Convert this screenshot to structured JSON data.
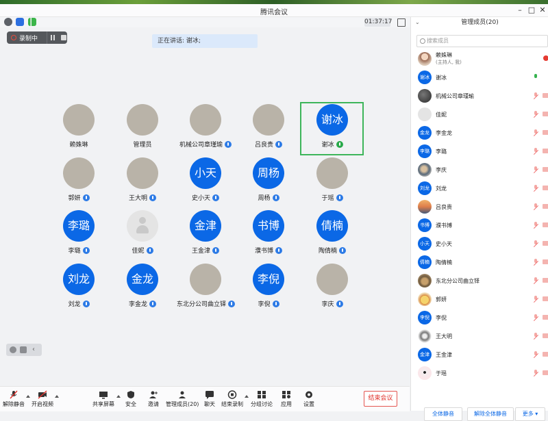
{
  "window": {
    "title": "腾讯会议",
    "minimize_icon": "minimize-icon",
    "maximize_icon": "maximize-icon",
    "close_icon": "close-icon"
  },
  "statusbar": {
    "timer": "01:37:17"
  },
  "recording": {
    "label": "录制中"
  },
  "speaking": {
    "text": "正在讲话: 谢冰;"
  },
  "grid": [
    {
      "name": "赖姝琳",
      "initials": "",
      "style": "photo-kid",
      "mic": "none"
    },
    {
      "name": "管理员",
      "initials": "",
      "style": "photo-sky",
      "mic": "none"
    },
    {
      "name": "机械公司章瑾瑜",
      "initials": "",
      "style": "photo-dark",
      "mic": "blue"
    },
    {
      "name": "吕良贵",
      "initials": "",
      "style": "photo-sunset",
      "mic": "blue"
    },
    {
      "name": "谢冰",
      "initials": "谢冰",
      "style": "blue",
      "mic": "on"
    },
    {
      "name": "郭妍",
      "initials": "",
      "style": "photo-cartoon",
      "mic": "blue"
    },
    {
      "name": "王大明",
      "initials": "",
      "style": "photo-lion",
      "mic": "blue"
    },
    {
      "name": "史小天",
      "initials": "小天",
      "style": "blue",
      "mic": "blue"
    },
    {
      "name": "周杨",
      "initials": "周杨",
      "style": "blue",
      "mic": "blue"
    },
    {
      "name": "于瑶",
      "initials": "",
      "style": "photo-white",
      "mic": "blue"
    },
    {
      "name": "李璐",
      "initials": "李璐",
      "style": "blue",
      "mic": "blue"
    },
    {
      "name": "佳妮",
      "initials": "",
      "style": "gray",
      "mic": "blue"
    },
    {
      "name": "王金津",
      "initials": "金津",
      "style": "blue",
      "mic": "blue"
    },
    {
      "name": "濮书博",
      "initials": "书博",
      "style": "blue",
      "mic": "blue"
    },
    {
      "name": "陶倩楠",
      "initials": "倩楠",
      "style": "blue",
      "mic": "blue"
    },
    {
      "name": "刘龙",
      "initials": "刘龙",
      "style": "blue",
      "mic": "blue"
    },
    {
      "name": "李金龙",
      "initials": "金龙",
      "style": "blue",
      "mic": "blue"
    },
    {
      "name": "东北分公司曲立铎",
      "initials": "",
      "style": "photo-dog",
      "mic": "blue"
    },
    {
      "name": "李倪",
      "initials": "李倪",
      "style": "blue",
      "mic": "blue"
    },
    {
      "name": "李庆",
      "initials": "",
      "style": "photo-family",
      "mic": "blue"
    }
  ],
  "toolbar": {
    "unmute": "解除静音",
    "start_video": "开启视频",
    "share_screen": "共享屏幕",
    "security": "安全",
    "invite": "邀请",
    "manage_members": "管理成员(20)",
    "chat": "聊天",
    "end_recording": "结束录制",
    "breakout": "分组讨论",
    "apps": "应用",
    "settings": "设置",
    "end_meeting": "结束会议"
  },
  "panel": {
    "title": "管理成员(20)",
    "search_placeholder": "搜索成员",
    "members": [
      {
        "name": "赖姝琳",
        "sub": "(主持人, 我)",
        "initials": "",
        "style": "photo-kid",
        "mic": "rec"
      },
      {
        "name": "谢冰",
        "sub": "",
        "initials": "谢冰",
        "style": "blue",
        "mic": "on"
      },
      {
        "name": "机械公司章瑾瑜",
        "sub": "",
        "initials": "",
        "style": "photo-dark",
        "mic": "muted"
      },
      {
        "name": "佳妮",
        "sub": "",
        "initials": "",
        "style": "gray",
        "mic": "muted"
      },
      {
        "name": "李金龙",
        "sub": "",
        "initials": "金龙",
        "style": "blue",
        "mic": "muted"
      },
      {
        "name": "李璐",
        "sub": "",
        "initials": "李璐",
        "style": "blue",
        "mic": "muted"
      },
      {
        "name": "李庆",
        "sub": "",
        "initials": "",
        "style": "photo-family",
        "mic": "muted"
      },
      {
        "name": "刘龙",
        "sub": "",
        "initials": "刘龙",
        "style": "blue",
        "mic": "muted"
      },
      {
        "name": "吕良贵",
        "sub": "",
        "initials": "",
        "style": "photo-sunset",
        "mic": "muted"
      },
      {
        "name": "濮书博",
        "sub": "",
        "initials": "书博",
        "style": "blue",
        "mic": "muted"
      },
      {
        "name": "史小天",
        "sub": "",
        "initials": "小天",
        "style": "blue",
        "mic": "muted"
      },
      {
        "name": "陶倩楠",
        "sub": "",
        "initials": "倩楠",
        "style": "blue",
        "mic": "muted"
      },
      {
        "name": "东北分公司曲立铎",
        "sub": "",
        "initials": "",
        "style": "photo-dog",
        "mic": "muted"
      },
      {
        "name": "郭妍",
        "sub": "",
        "initials": "",
        "style": "photo-cartoon",
        "mic": "muted"
      },
      {
        "name": "李倪",
        "sub": "",
        "initials": "李倪",
        "style": "blue",
        "mic": "muted"
      },
      {
        "name": "王大明",
        "sub": "",
        "initials": "",
        "style": "photo-lion",
        "mic": "muted"
      },
      {
        "name": "王金津",
        "sub": "",
        "initials": "金津",
        "style": "blue",
        "mic": "muted"
      },
      {
        "name": "于瑶",
        "sub": "",
        "initials": "",
        "style": "photo-white",
        "mic": "muted"
      }
    ],
    "mute_all": "全体静音",
    "unmute_all": "解除全体静音",
    "more": "更多"
  },
  "colors": {
    "accent": "#0b68e6",
    "speaker_border": "#3db55a",
    "end_red": "#e0312b"
  }
}
